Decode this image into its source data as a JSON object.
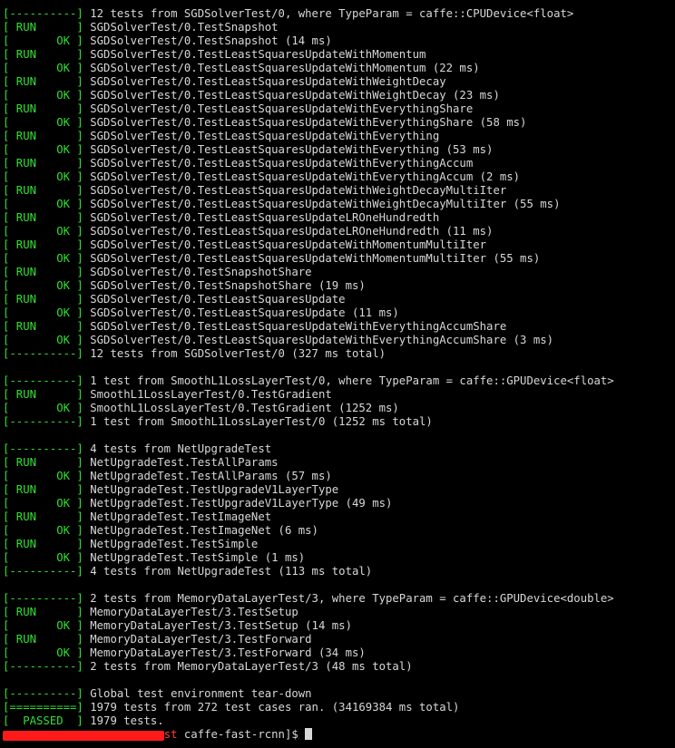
{
  "lines": [
    {
      "tag": "[----------]",
      "text": " 12 tests from SGDSolverTest/0, where TypeParam = caffe::CPUDevice<float>"
    },
    {
      "tag": "[ RUN      ]",
      "text": " SGDSolverTest/0.TestSnapshot"
    },
    {
      "tag": "[       OK ]",
      "text": " SGDSolverTest/0.TestSnapshot (14 ms)"
    },
    {
      "tag": "[ RUN      ]",
      "text": " SGDSolverTest/0.TestLeastSquaresUpdateWithMomentum"
    },
    {
      "tag": "[       OK ]",
      "text": " SGDSolverTest/0.TestLeastSquaresUpdateWithMomentum (22 ms)"
    },
    {
      "tag": "[ RUN      ]",
      "text": " SGDSolverTest/0.TestLeastSquaresUpdateWithWeightDecay"
    },
    {
      "tag": "[       OK ]",
      "text": " SGDSolverTest/0.TestLeastSquaresUpdateWithWeightDecay (23 ms)"
    },
    {
      "tag": "[ RUN      ]",
      "text": " SGDSolverTest/0.TestLeastSquaresUpdateWithEverythingShare"
    },
    {
      "tag": "[       OK ]",
      "text": " SGDSolverTest/0.TestLeastSquaresUpdateWithEverythingShare (58 ms)"
    },
    {
      "tag": "[ RUN      ]",
      "text": " SGDSolverTest/0.TestLeastSquaresUpdateWithEverything"
    },
    {
      "tag": "[       OK ]",
      "text": " SGDSolverTest/0.TestLeastSquaresUpdateWithEverything (53 ms)"
    },
    {
      "tag": "[ RUN      ]",
      "text": " SGDSolverTest/0.TestLeastSquaresUpdateWithEverythingAccum"
    },
    {
      "tag": "[       OK ]",
      "text": " SGDSolverTest/0.TestLeastSquaresUpdateWithEverythingAccum (2 ms)"
    },
    {
      "tag": "[ RUN      ]",
      "text": " SGDSolverTest/0.TestLeastSquaresUpdateWithWeightDecayMultiIter"
    },
    {
      "tag": "[       OK ]",
      "text": " SGDSolverTest/0.TestLeastSquaresUpdateWithWeightDecayMultiIter (55 ms)"
    },
    {
      "tag": "[ RUN      ]",
      "text": " SGDSolverTest/0.TestLeastSquaresUpdateLROneHundredth"
    },
    {
      "tag": "[       OK ]",
      "text": " SGDSolverTest/0.TestLeastSquaresUpdateLROneHundredth (11 ms)"
    },
    {
      "tag": "[ RUN      ]",
      "text": " SGDSolverTest/0.TestLeastSquaresUpdateWithMomentumMultiIter"
    },
    {
      "tag": "[       OK ]",
      "text": " SGDSolverTest/0.TestLeastSquaresUpdateWithMomentumMultiIter (55 ms)"
    },
    {
      "tag": "[ RUN      ]",
      "text": " SGDSolverTest/0.TestSnapshotShare"
    },
    {
      "tag": "[       OK ]",
      "text": " SGDSolverTest/0.TestSnapshotShare (19 ms)"
    },
    {
      "tag": "[ RUN      ]",
      "text": " SGDSolverTest/0.TestLeastSquaresUpdate"
    },
    {
      "tag": "[       OK ]",
      "text": " SGDSolverTest/0.TestLeastSquaresUpdate (11 ms)"
    },
    {
      "tag": "[ RUN      ]",
      "text": " SGDSolverTest/0.TestLeastSquaresUpdateWithEverythingAccumShare"
    },
    {
      "tag": "[       OK ]",
      "text": " SGDSolverTest/0.TestLeastSquaresUpdateWithEverythingAccumShare (3 ms)"
    },
    {
      "tag": "[----------]",
      "text": " 12 tests from SGDSolverTest/0 (327 ms total)"
    },
    {
      "tag": "",
      "text": ""
    },
    {
      "tag": "[----------]",
      "text": " 1 test from SmoothL1LossLayerTest/0, where TypeParam = caffe::GPUDevice<float>"
    },
    {
      "tag": "[ RUN      ]",
      "text": " SmoothL1LossLayerTest/0.TestGradient"
    },
    {
      "tag": "[       OK ]",
      "text": " SmoothL1LossLayerTest/0.TestGradient (1252 ms)"
    },
    {
      "tag": "[----------]",
      "text": " 1 test from SmoothL1LossLayerTest/0 (1252 ms total)"
    },
    {
      "tag": "",
      "text": ""
    },
    {
      "tag": "[----------]",
      "text": " 4 tests from NetUpgradeTest"
    },
    {
      "tag": "[ RUN      ]",
      "text": " NetUpgradeTest.TestAllParams"
    },
    {
      "tag": "[       OK ]",
      "text": " NetUpgradeTest.TestAllParams (57 ms)"
    },
    {
      "tag": "[ RUN      ]",
      "text": " NetUpgradeTest.TestUpgradeV1LayerType"
    },
    {
      "tag": "[       OK ]",
      "text": " NetUpgradeTest.TestUpgradeV1LayerType (49 ms)"
    },
    {
      "tag": "[ RUN      ]",
      "text": " NetUpgradeTest.TestImageNet"
    },
    {
      "tag": "[       OK ]",
      "text": " NetUpgradeTest.TestImageNet (6 ms)"
    },
    {
      "tag": "[ RUN      ]",
      "text": " NetUpgradeTest.TestSimple"
    },
    {
      "tag": "[       OK ]",
      "text": " NetUpgradeTest.TestSimple (1 ms)"
    },
    {
      "tag": "[----------]",
      "text": " 4 tests from NetUpgradeTest (113 ms total)"
    },
    {
      "tag": "",
      "text": ""
    },
    {
      "tag": "[----------]",
      "text": " 2 tests from MemoryDataLayerTest/3, where TypeParam = caffe::GPUDevice<double>"
    },
    {
      "tag": "[ RUN      ]",
      "text": " MemoryDataLayerTest/3.TestSetup"
    },
    {
      "tag": "[       OK ]",
      "text": " MemoryDataLayerTest/3.TestSetup (14 ms)"
    },
    {
      "tag": "[ RUN      ]",
      "text": " MemoryDataLayerTest/3.TestForward"
    },
    {
      "tag": "[       OK ]",
      "text": " MemoryDataLayerTest/3.TestForward (34 ms)"
    },
    {
      "tag": "[----------]",
      "text": " 2 tests from MemoryDataLayerTest/3 (48 ms total)"
    },
    {
      "tag": "",
      "text": ""
    },
    {
      "tag": "[----------]",
      "text": " Global test environment tear-down"
    },
    {
      "tag": "[==========]",
      "text": " 1979 tests from 272 test cases ran. (34169384 ms total)"
    },
    {
      "tag": "[  PASSED  ]",
      "text": " 1979 tests."
    }
  ],
  "prompt": {
    "host_visible": "st",
    "dir": " caffe-fast-rcnn]$ "
  },
  "colors": {
    "background": "#000000",
    "text": "#d8d8d8",
    "tag_green": "#2fe02f",
    "redaction_red": "#ff1a1a"
  }
}
